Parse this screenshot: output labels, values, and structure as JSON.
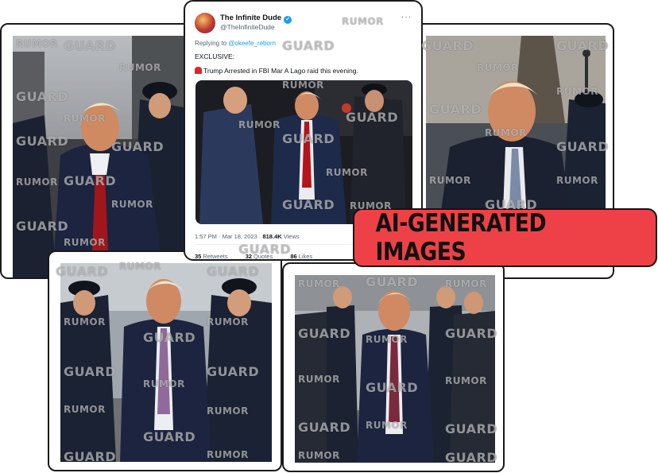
{
  "watermark": {
    "line1": "RUMOR",
    "line2": "GUARD"
  },
  "tweet": {
    "display_name": "The Infinite Dude",
    "handle": "@TheInfiniteDude",
    "more": "···",
    "reply_prefix": "Replying to ",
    "reply_mention": "@okeefe_reborn",
    "line1": "EXCLUSIVE:",
    "line2": "Trump Arrested in FBI Mar A Lago raid this evening.",
    "timestamp": "1:57 PM · Mar 18, 2023 · ",
    "views_count": "818.4K",
    "views_label": " Views",
    "retweets_count": "35",
    "retweets_label": "Retweets",
    "quotes_count": "32",
    "quotes_label": "Quotes",
    "likes_count": "86",
    "likes_label": "Likes"
  },
  "badge": {
    "label": "AI-GENERATED IMAGES"
  },
  "colors": {
    "badge_bg": "#ee4147",
    "verified": "#1d9bf0",
    "mention": "#1d9bf0"
  }
}
